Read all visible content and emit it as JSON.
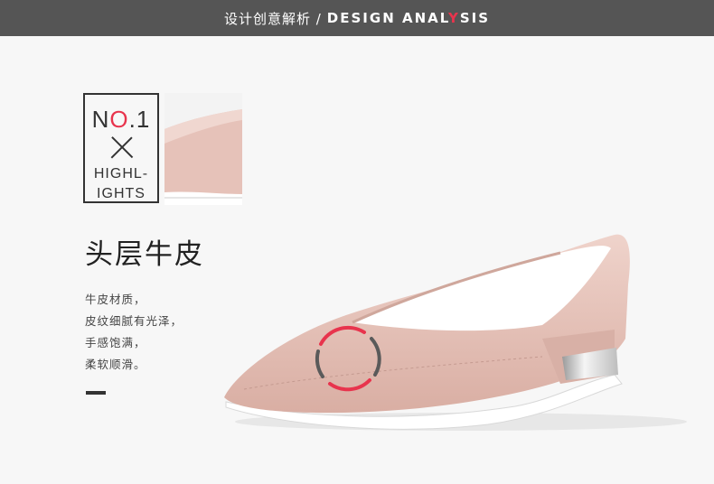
{
  "header": {
    "title_cn": "设计创意解析 /",
    "title_en_a": "DESIGN ANAL",
    "title_en_b": "Y",
    "title_en_c": "SIS"
  },
  "highlight": {
    "no_a": "N",
    "no_b": "O",
    "no_c": ".1",
    "line1": "HIGHL-",
    "line2": "IGHTS"
  },
  "feature": {
    "title": "头层牛皮",
    "lines": [
      "牛皮材质，",
      "皮纹细腻有光泽，",
      "手感饱满，",
      "柔软顺滑。"
    ]
  },
  "colors": {
    "accent": "#e8344d",
    "bar": "#555555",
    "shoe": "#e8c4bb"
  }
}
